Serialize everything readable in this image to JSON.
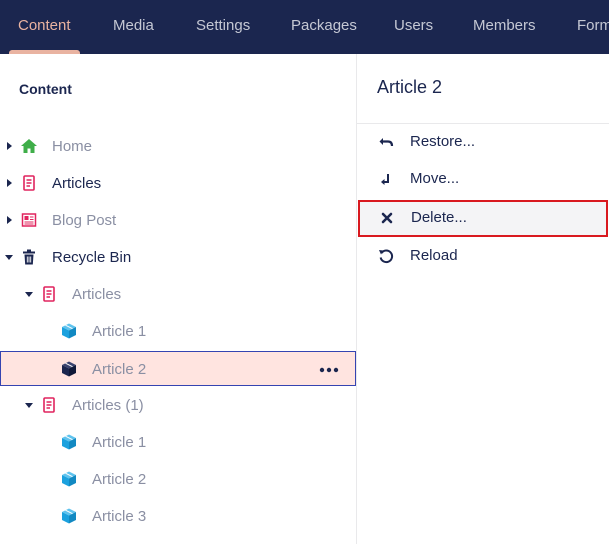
{
  "nav": {
    "items": [
      {
        "label": "Content",
        "active": true
      },
      {
        "label": "Media"
      },
      {
        "label": "Settings"
      },
      {
        "label": "Packages"
      },
      {
        "label": "Users"
      },
      {
        "label": "Members"
      },
      {
        "label": "Forms"
      }
    ]
  },
  "tree": {
    "heading": "Content",
    "nodes": [
      {
        "label": "Home",
        "icon": "home-icon"
      },
      {
        "label": "Articles",
        "icon": "article-list-icon"
      },
      {
        "label": "Blog Post",
        "icon": "blog-post-icon"
      },
      {
        "label": "Recycle Bin",
        "icon": "trash-icon"
      },
      {
        "label": "Articles",
        "icon": "article-list-icon"
      },
      {
        "label": "Article 1",
        "icon": "cube-icon"
      },
      {
        "label": "Article 2",
        "icon": "cube-icon",
        "selected": true
      },
      {
        "label": "Articles (1)",
        "icon": "article-list-icon"
      },
      {
        "label": "Article 1",
        "icon": "cube-icon"
      },
      {
        "label": "Article 2",
        "icon": "cube-icon"
      },
      {
        "label": "Article 3",
        "icon": "cube-icon"
      }
    ]
  },
  "actions_panel": {
    "title": "Article 2",
    "items": [
      {
        "label": "Restore...",
        "icon": "undo-icon"
      },
      {
        "label": "Move...",
        "icon": "move-icon"
      },
      {
        "label": "Delete...",
        "icon": "delete-icon",
        "highlighted": true
      },
      {
        "label": "Reload",
        "icon": "reload-icon"
      }
    ]
  },
  "colors": {
    "nav_bg": "#1b264f",
    "nav_active": "#e9b3a1",
    "selected_row_bg": "#ffe4e0",
    "selected_row_border": "#3544b1",
    "highlight_border": "#d9191f",
    "home_icon": "#3fae49",
    "article_icon": "#e0245e",
    "cube_icon": "#1ca1de"
  }
}
